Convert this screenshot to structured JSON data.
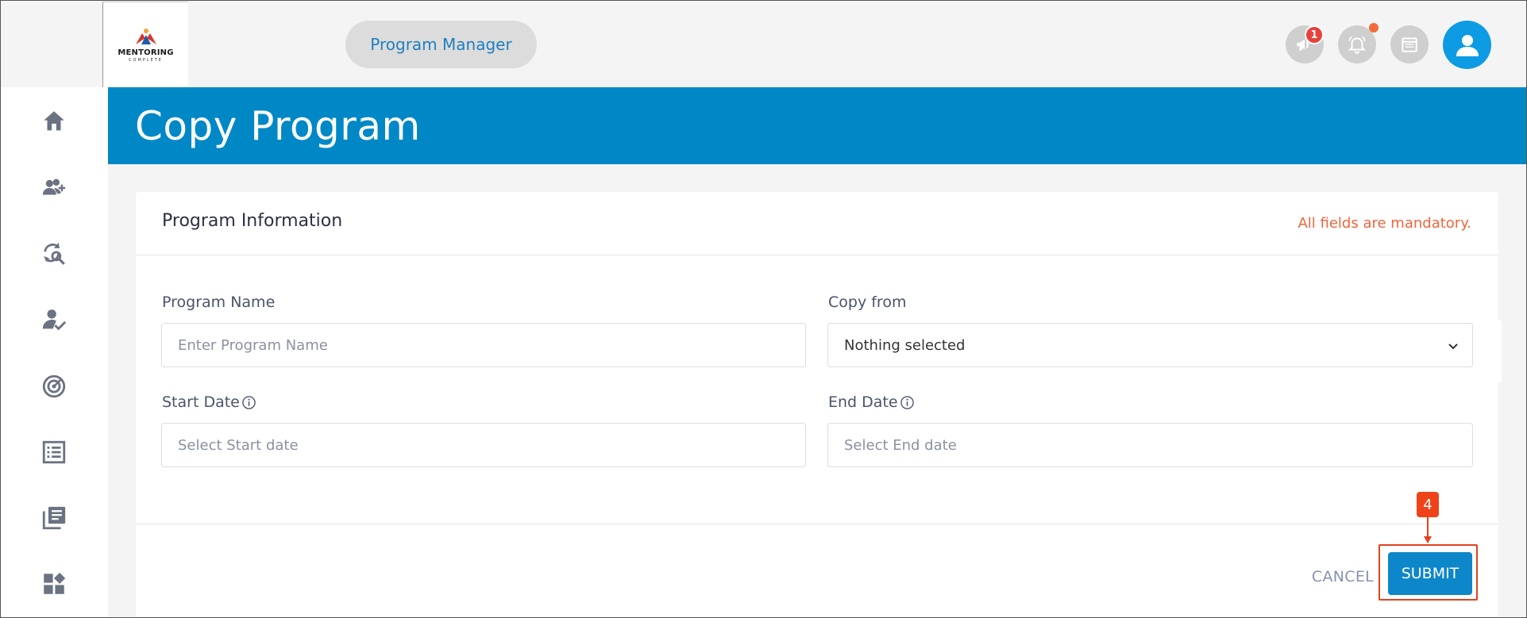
{
  "header": {
    "logo_name": "MENTORING",
    "logo_sub": "COMPLETE",
    "role_label": "Program Manager",
    "announcement_count": "1",
    "icons": [
      "megaphone-icon",
      "bell-icon",
      "calendar-icon",
      "user-avatar-icon"
    ]
  },
  "sidebar": {
    "icons": [
      "home-icon",
      "add-user-icon",
      "search-refresh-icon",
      "user-check-icon",
      "target-icon",
      "list-icon",
      "library-icon",
      "widgets-icon"
    ]
  },
  "page": {
    "title": "Copy Program"
  },
  "form": {
    "section_title": "Program Information",
    "mandatory_note": "All fields are mandatory.",
    "program_name_label": "Program Name",
    "program_name_placeholder": "Enter Program Name",
    "copy_from_label": "Copy from",
    "copy_from_value": "Nothing selected",
    "start_date_label": "Start Date",
    "start_date_placeholder": "Select Start date",
    "end_date_label": "End Date",
    "end_date_placeholder": "Select End date",
    "cancel_label": "CANCEL",
    "submit_label": "SUBMIT"
  },
  "annotation": {
    "step": "4"
  },
  "colors": {
    "brand_blue": "#0088c6",
    "submit_blue": "#0d87c9",
    "mandatory_orange": "#f2643c",
    "highlight_red": "#e2421f",
    "avatar_blue": "#0d9be3"
  }
}
